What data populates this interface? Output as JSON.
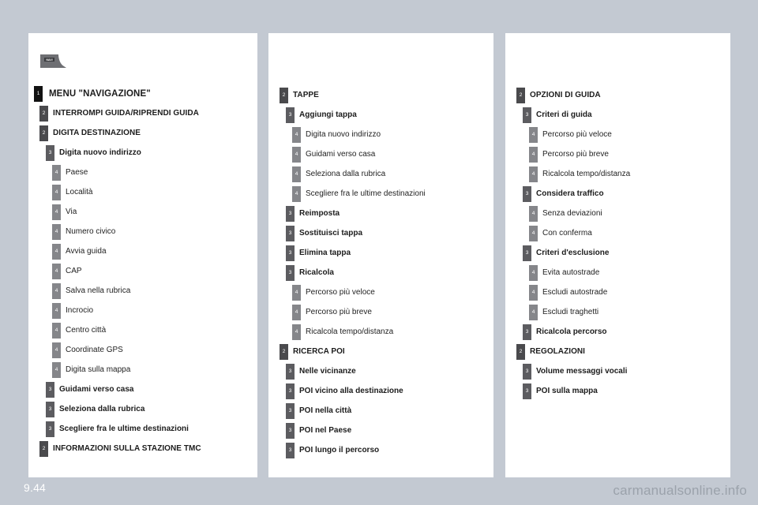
{
  "page": {
    "number": "9.44",
    "watermark": "carmanualsonline.info",
    "background_color": "#c3c9d2",
    "panel_color": "#ffffff"
  },
  "icon": {
    "navi_label": "NAVI",
    "name": "navi-key-icon"
  },
  "level_colors": {
    "1": "#121212",
    "2": "#4a4a4d",
    "3": "#5c5c60",
    "4": "#85868a"
  },
  "panels": [
    {
      "id": "panel-1",
      "rows": [
        {
          "level": 1,
          "badge": "1",
          "label": "MENU \"NAVIGAZIONE\""
        },
        {
          "level": 2,
          "badge": "2",
          "label": "INTERROMPI GUIDA/RIPRENDI GUIDA"
        },
        {
          "level": 2,
          "badge": "2",
          "label": "DIGITA DESTINAZIONE"
        },
        {
          "level": 3,
          "badge": "3",
          "label": "Digita nuovo indirizzo"
        },
        {
          "level": 4,
          "badge": "4",
          "label": "Paese"
        },
        {
          "level": 4,
          "badge": "4",
          "label": "Località"
        },
        {
          "level": 4,
          "badge": "4",
          "label": "Via"
        },
        {
          "level": 4,
          "badge": "4",
          "label": "Numero civico"
        },
        {
          "level": 4,
          "badge": "4",
          "label": "Avvia guida"
        },
        {
          "level": 4,
          "badge": "4",
          "label": "CAP"
        },
        {
          "level": 4,
          "badge": "4",
          "label": "Salva nella rubrica"
        },
        {
          "level": 4,
          "badge": "4",
          "label": "Incrocio"
        },
        {
          "level": 4,
          "badge": "4",
          "label": "Centro città"
        },
        {
          "level": 4,
          "badge": "4",
          "label": "Coordinate GPS"
        },
        {
          "level": 4,
          "badge": "4",
          "label": "Digita sulla mappa"
        },
        {
          "level": 3,
          "badge": "3",
          "label": "Guidami verso casa"
        },
        {
          "level": 3,
          "badge": "3",
          "label": "Seleziona dalla rubrica"
        },
        {
          "level": 3,
          "badge": "3",
          "label": "Scegliere fra le ultime destinazioni"
        },
        {
          "level": 2,
          "badge": "2",
          "label": "INFORMAZIONI SULLA STAZIONE TMC"
        }
      ]
    },
    {
      "id": "panel-2",
      "rows": [
        {
          "level": 2,
          "badge": "2",
          "label": "TAPPE"
        },
        {
          "level": 3,
          "badge": "3",
          "label": "Aggiungi tappa"
        },
        {
          "level": 4,
          "badge": "4",
          "label": "Digita nuovo indirizzo"
        },
        {
          "level": 4,
          "badge": "4",
          "label": "Guidami verso casa"
        },
        {
          "level": 4,
          "badge": "4",
          "label": "Seleziona dalla rubrica"
        },
        {
          "level": 4,
          "badge": "4",
          "label": "Scegliere fra le ultime destinazioni"
        },
        {
          "level": 3,
          "badge": "3",
          "label": "Reimposta"
        },
        {
          "level": 3,
          "badge": "3",
          "label": "Sostituisci tappa"
        },
        {
          "level": 3,
          "badge": "3",
          "label": "Elimina tappa"
        },
        {
          "level": 3,
          "badge": "3",
          "label": "Ricalcola"
        },
        {
          "level": 4,
          "badge": "4",
          "label": "Percorso più veloce"
        },
        {
          "level": 4,
          "badge": "4",
          "label": "Percorso più breve"
        },
        {
          "level": 4,
          "badge": "4",
          "label": "Ricalcola tempo/distanza"
        },
        {
          "level": 2,
          "badge": "2",
          "label": "RICERCA POI"
        },
        {
          "level": 3,
          "badge": "3",
          "label": "Nelle vicinanze"
        },
        {
          "level": 3,
          "badge": "3",
          "label": "POI vicino alla destinazione"
        },
        {
          "level": 3,
          "badge": "3",
          "label": "POI nella città"
        },
        {
          "level": 3,
          "badge": "3",
          "label": "POI nel Paese"
        },
        {
          "level": 3,
          "badge": "3",
          "label": "POI lungo il percorso"
        }
      ]
    },
    {
      "id": "panel-3",
      "rows": [
        {
          "level": 2,
          "badge": "2",
          "label": "OPZIONI DI GUIDA"
        },
        {
          "level": 3,
          "badge": "3",
          "label": "Criteri di guida"
        },
        {
          "level": 4,
          "badge": "4",
          "label": "Percorso più veloce"
        },
        {
          "level": 4,
          "badge": "4",
          "label": "Percorso più breve"
        },
        {
          "level": 4,
          "badge": "4",
          "label": "Ricalcola tempo/distanza"
        },
        {
          "level": 3,
          "badge": "3",
          "label": "Considera traffico"
        },
        {
          "level": 4,
          "badge": "4",
          "label": "Senza deviazioni"
        },
        {
          "level": 4,
          "badge": "4",
          "label": "Con conferma"
        },
        {
          "level": 3,
          "badge": "3",
          "label": "Criteri d'esclusione"
        },
        {
          "level": 4,
          "badge": "4",
          "label": "Evita autostrade"
        },
        {
          "level": 4,
          "badge": "4",
          "label": "Escludi autostrade"
        },
        {
          "level": 4,
          "badge": "4",
          "label": "Escludi traghetti"
        },
        {
          "level": 3,
          "badge": "3",
          "label": "Ricalcola percorso"
        },
        {
          "level": 2,
          "badge": "2",
          "label": "REGOLAZIONI"
        },
        {
          "level": 3,
          "badge": "3",
          "label": "Volume messaggi vocali"
        },
        {
          "level": 3,
          "badge": "3",
          "label": "POI sulla mappa"
        }
      ]
    }
  ]
}
